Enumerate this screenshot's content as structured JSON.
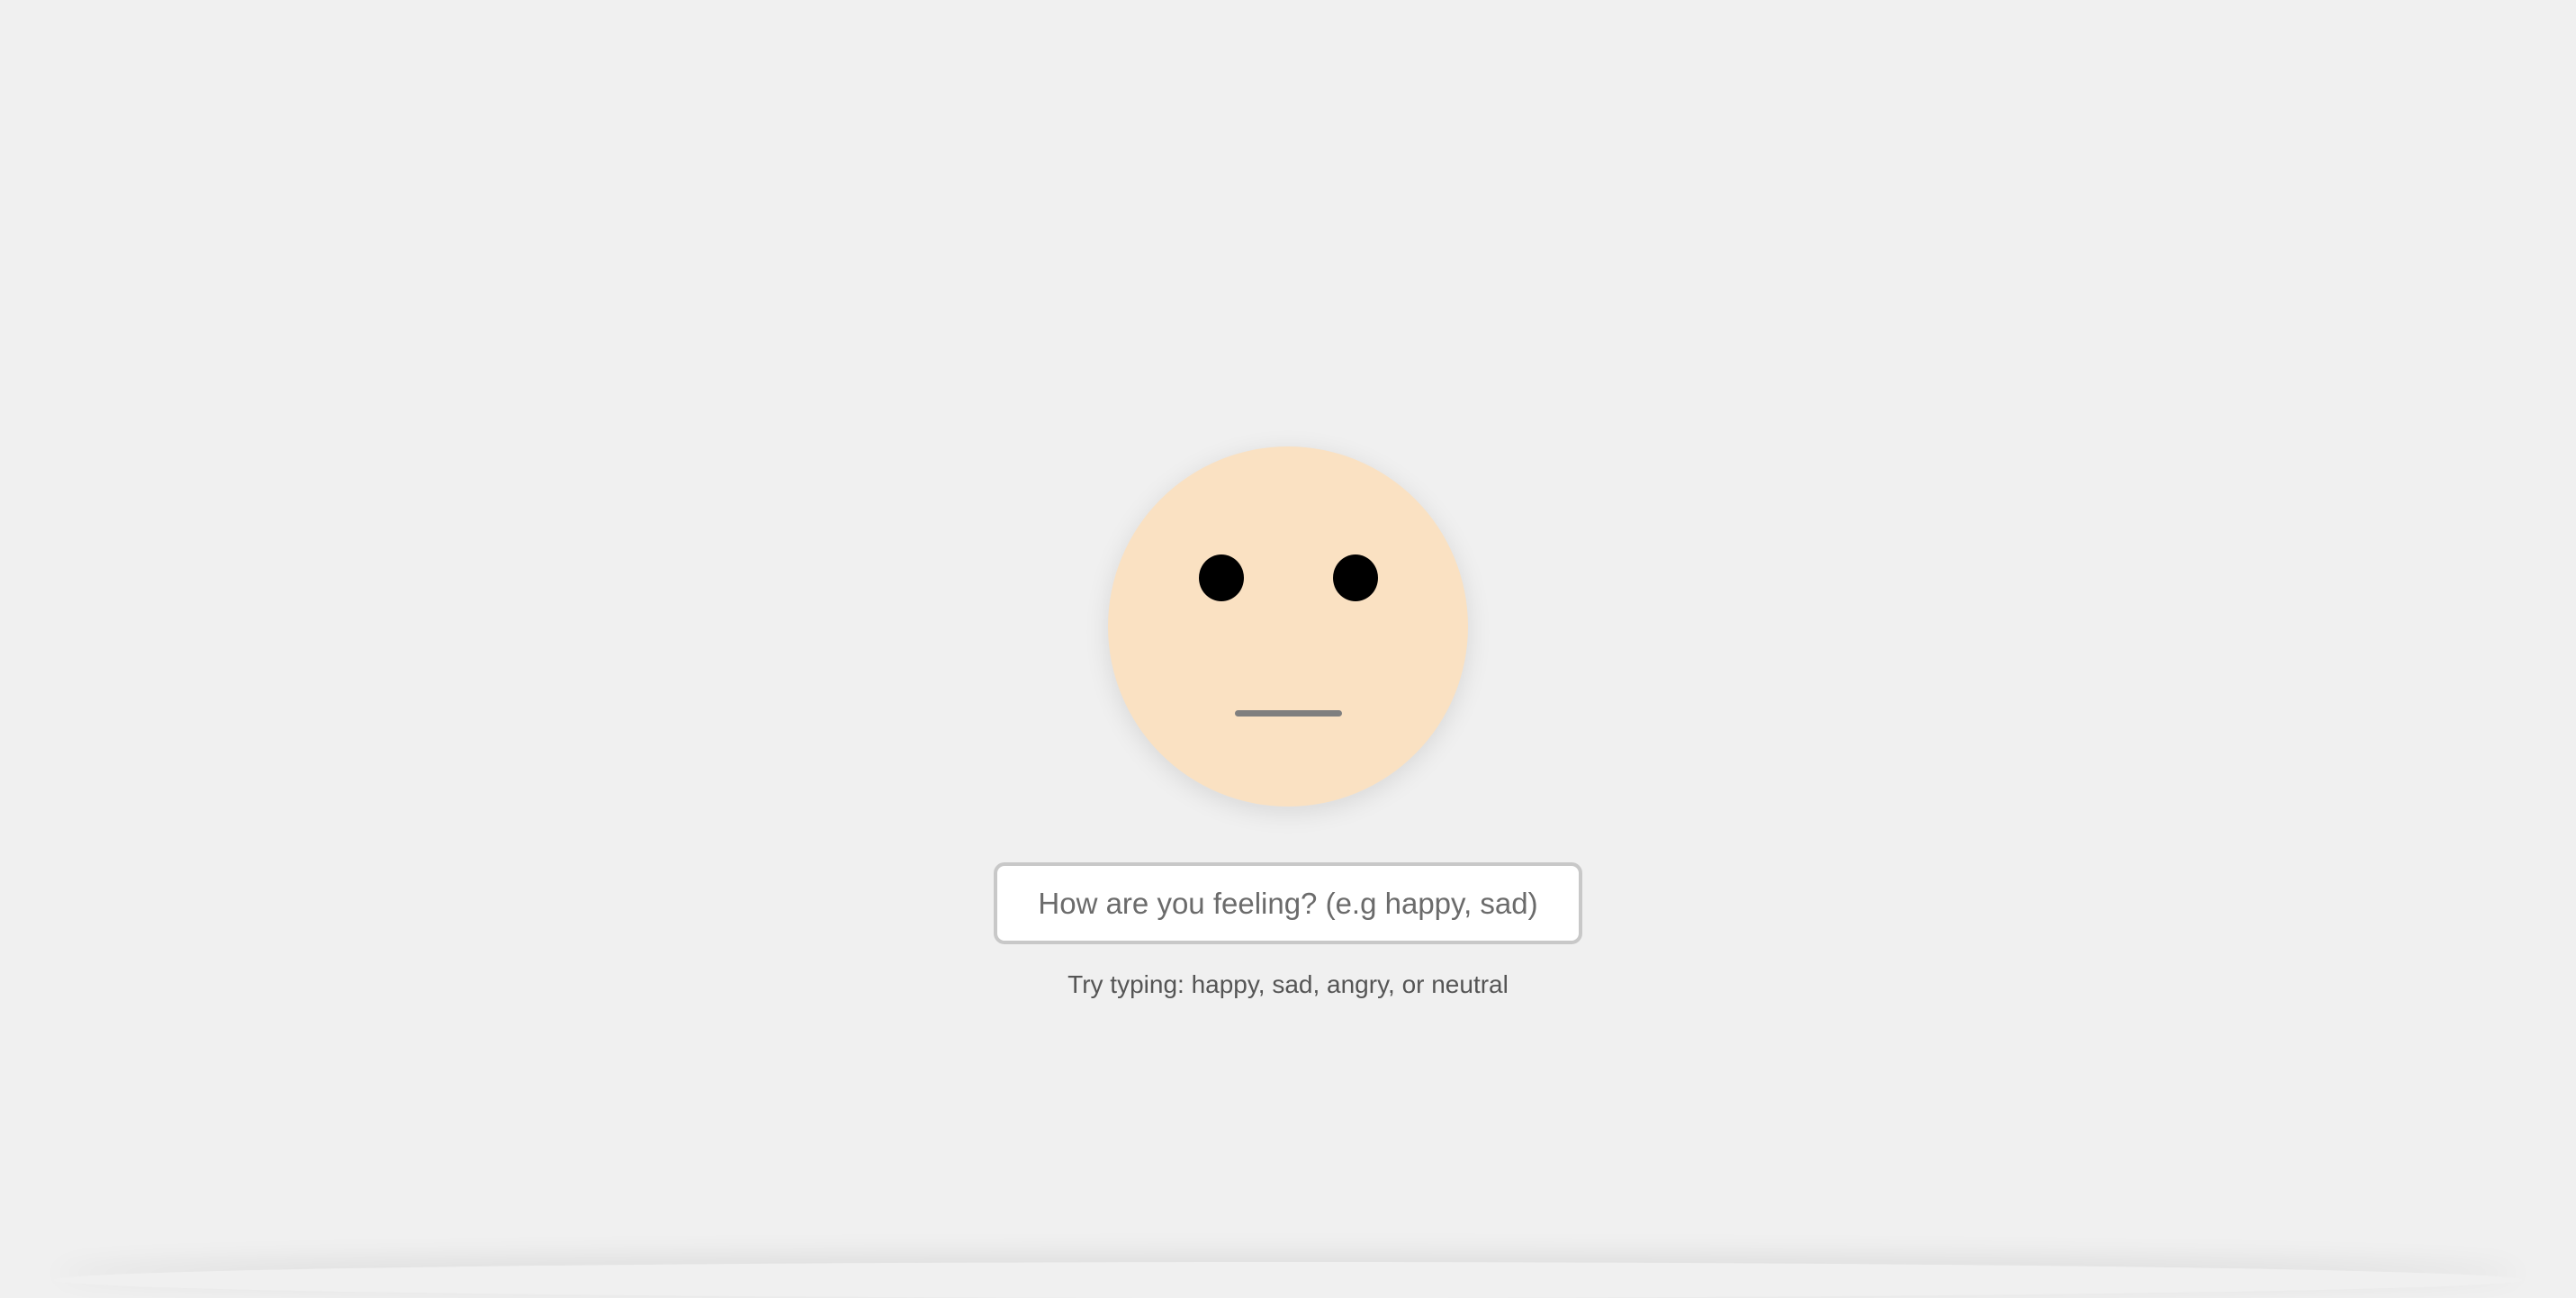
{
  "colors": {
    "background": "#f0f0f0",
    "face": "#fae1c2",
    "eyes": "#000000",
    "mouth": "#7f7f7f",
    "input_border": "#c8c8c8"
  },
  "face": {
    "mood": "neutral"
  },
  "mood_input": {
    "placeholder": "How are you feeling? (e.g happy, sad)",
    "value": ""
  },
  "hint": {
    "text": "Try typing: happy, sad, angry, or neutral"
  }
}
